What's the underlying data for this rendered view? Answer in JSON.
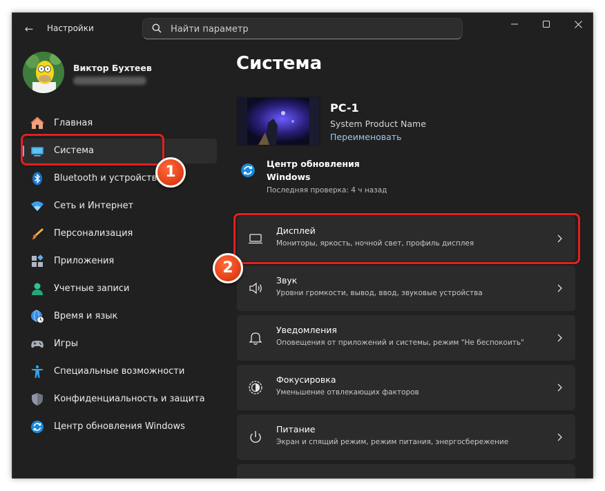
{
  "window": {
    "title": "Настройки",
    "search_placeholder": "Найти параметр"
  },
  "profile": {
    "name": "Виктор Бухтеев"
  },
  "sidebar": {
    "items": [
      {
        "label": "Главная",
        "icon": "home-icon"
      },
      {
        "label": "Система",
        "icon": "system-icon",
        "active": true
      },
      {
        "label": "Bluetooth и устройства",
        "icon": "bluetooth-icon"
      },
      {
        "label": "Сеть и Интернет",
        "icon": "wifi-icon"
      },
      {
        "label": "Персонализация",
        "icon": "brush-icon"
      },
      {
        "label": "Приложения",
        "icon": "apps-icon"
      },
      {
        "label": "Учетные записи",
        "icon": "account-icon"
      },
      {
        "label": "Время и язык",
        "icon": "globe-clock-icon"
      },
      {
        "label": "Игры",
        "icon": "gamepad-icon"
      },
      {
        "label": "Специальные возможности",
        "icon": "accessibility-icon"
      },
      {
        "label": "Конфиденциальность и защита",
        "icon": "shield-icon"
      },
      {
        "label": "Центр обновления Windows",
        "icon": "update-icon"
      }
    ]
  },
  "main": {
    "title": "Система",
    "device": {
      "name": "PC-1",
      "model": "System Product Name",
      "rename_label": "Переименовать"
    },
    "update": {
      "title": "Центр обновления Windows",
      "subtitle": "Последняя проверка: 4 ч назад"
    },
    "cards": [
      {
        "title": "Дисплей",
        "subtitle": "Мониторы, яркость, ночной свет, профиль дисплея",
        "icon": "display-icon"
      },
      {
        "title": "Звук",
        "subtitle": "Уровни громкости, вывод, ввод, звуковые устройства",
        "icon": "speaker-icon"
      },
      {
        "title": "Уведомления",
        "subtitle": "Оповещения от приложений и системы, режим \"Не беспокоить\"",
        "icon": "bell-icon"
      },
      {
        "title": "Фокусировка",
        "subtitle": "Уменьшение отвлекающих факторов",
        "icon": "focus-icon"
      },
      {
        "title": "Питание",
        "subtitle": "Экран и спящий режим, режим питания, энергосбережение",
        "icon": "power-icon"
      }
    ]
  },
  "annotations": {
    "badge_1": "1",
    "badge_2": "2"
  },
  "colors": {
    "accent": "#4cc2ff",
    "highlight": "#e41f1f",
    "badge": "#e8471c",
    "window_bg": "#202020",
    "card_bg": "#2b2b2b"
  }
}
